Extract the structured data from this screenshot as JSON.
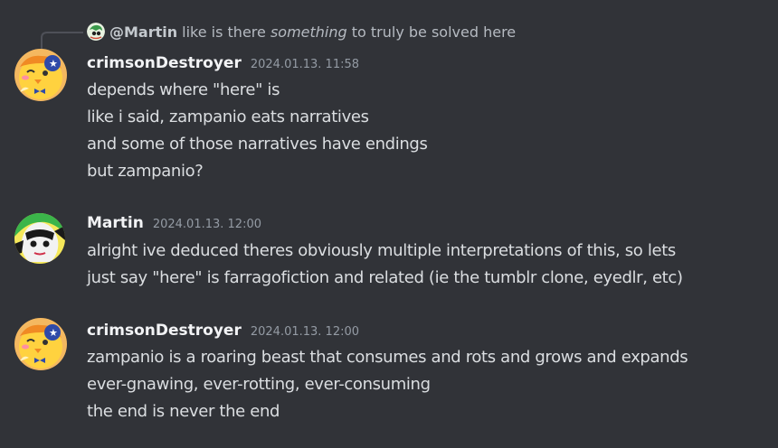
{
  "reply": {
    "mention": "@Martin",
    "text_before": "like is there ",
    "text_em": "something",
    "text_after": " to truly be solved here"
  },
  "messages": [
    {
      "author": "crimsonDestroyer",
      "timestamp": "2024.01.13. 11:58",
      "avatar": "chick-mascot-avatar",
      "lines": [
        "depends where \"here\" is",
        "like i said, zampanio eats narratives",
        "and some of those narratives have endings",
        "but zampanio?"
      ]
    },
    {
      "author": "Martin",
      "timestamp": "2024.01.13. 12:00",
      "avatar": "anime-character-avatar",
      "lines": [
        "alright ive deduced theres obviously multiple interpretations of this, so lets",
        "just say \"here\" is farragofiction and related (ie the tumblr clone, eyedlr, etc)"
      ]
    },
    {
      "author": "crimsonDestroyer",
      "timestamp": "2024.01.13. 12:00",
      "avatar": "chick-mascot-avatar",
      "lines": [
        "zampanio is a roaring beast that consumes and rots and grows and expands",
        "ever-gnawing, ever-rotting, ever-consuming",
        "the end is never the end"
      ]
    }
  ],
  "colors": {
    "background": "#313338",
    "username": "#f2f3f5",
    "message_text": "#dbdee1",
    "timestamp": "#949ba4",
    "reply_text": "#b5bac1"
  }
}
